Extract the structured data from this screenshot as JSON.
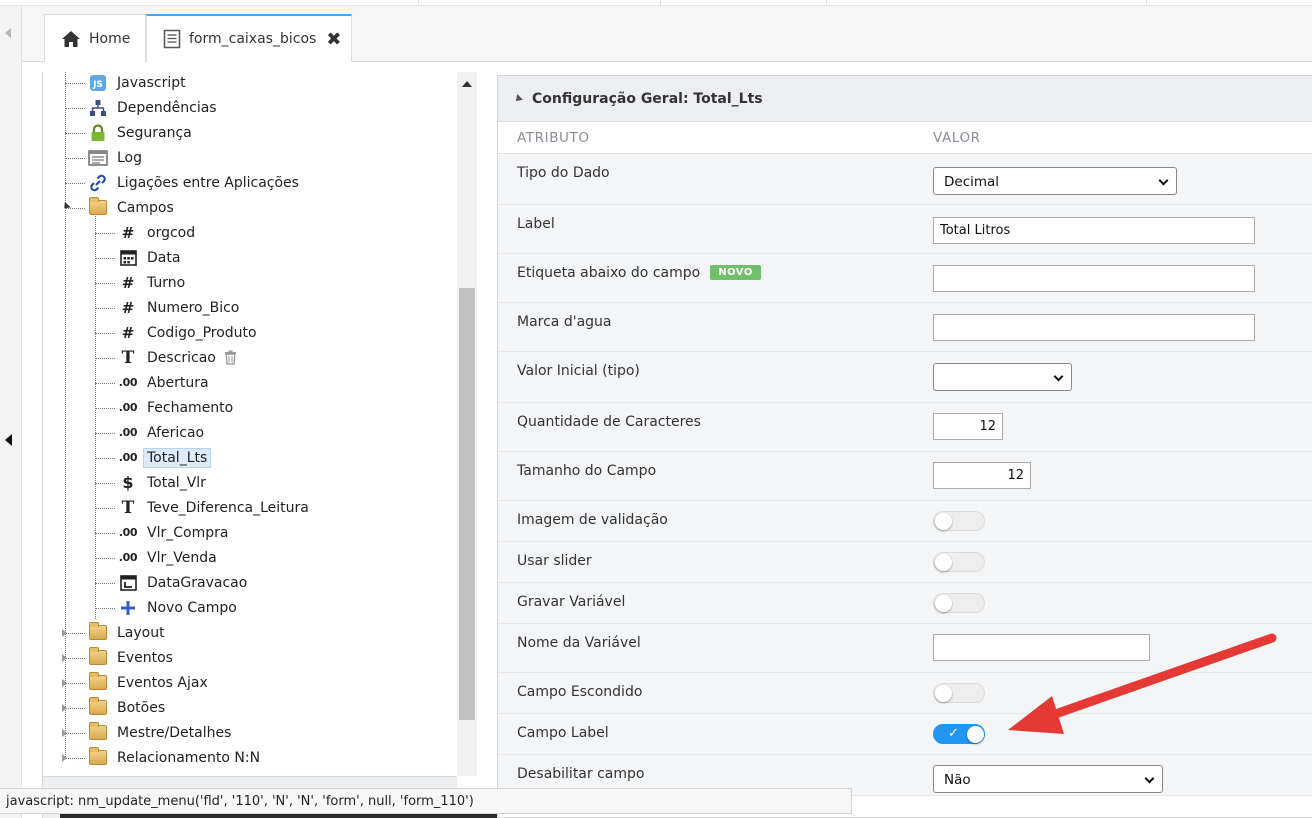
{
  "tabs": [
    {
      "label": "Home",
      "icon": "home-icon"
    },
    {
      "label": "form_caixas_bicos",
      "icon": "document-icon",
      "closable": true
    }
  ],
  "tree": {
    "items": [
      {
        "label": "Javascript",
        "icon": "js-icon"
      },
      {
        "label": "Dependências",
        "icon": "sitemap-icon"
      },
      {
        "label": "Segurança",
        "icon": "lock-icon"
      },
      {
        "label": "Log",
        "icon": "log-icon"
      },
      {
        "label": "Ligações entre Aplicações",
        "icon": "link-icon"
      },
      {
        "label": "Campos",
        "icon": "folder-icon",
        "expanded": true
      },
      {
        "label": "orgcod",
        "icon": "hash-icon",
        "glyph": "#"
      },
      {
        "label": "Data",
        "icon": "calendar-icon"
      },
      {
        "label": "Turno",
        "icon": "hash-icon",
        "glyph": "#"
      },
      {
        "label": "Numero_Bico",
        "icon": "hash-icon",
        "glyph": "#"
      },
      {
        "label": "Codigo_Produto",
        "icon": "hash-icon",
        "glyph": "#"
      },
      {
        "label": "Descricao",
        "icon": "text-icon",
        "glyph": "T",
        "trash": true
      },
      {
        "label": "Abertura",
        "icon": "decimal-icon",
        "glyph": ".00"
      },
      {
        "label": "Fechamento",
        "icon": "decimal-icon",
        "glyph": ".00"
      },
      {
        "label": "Afericao",
        "icon": "decimal-icon",
        "glyph": ".00"
      },
      {
        "label": "Total_Lts",
        "icon": "decimal-icon",
        "glyph": ".00",
        "selected": true
      },
      {
        "label": "Total_Vlr",
        "icon": "currency-icon",
        "glyph": "$"
      },
      {
        "label": "Teve_Diferenca_Leitura",
        "icon": "text-icon",
        "glyph": "T"
      },
      {
        "label": "Vlr_Compra",
        "icon": "decimal-icon",
        "glyph": ".00"
      },
      {
        "label": "Vlr_Venda",
        "icon": "decimal-icon",
        "glyph": ".00"
      },
      {
        "label": "DataGravacao",
        "icon": "datetime-icon"
      },
      {
        "label": "Novo Campo",
        "icon": "plus-icon",
        "glyph": "+"
      },
      {
        "label": "Layout",
        "icon": "folder-icon"
      },
      {
        "label": "Eventos",
        "icon": "folder-icon"
      },
      {
        "label": "Eventos Ajax",
        "icon": "folder-icon"
      },
      {
        "label": "Botões",
        "icon": "folder-icon"
      },
      {
        "label": "Mestre/Detalhes",
        "icon": "folder-icon"
      },
      {
        "label": "Relacionamento N:N",
        "icon": "folder-icon"
      }
    ]
  },
  "config": {
    "title": "Configuração Geral: Total_Lts",
    "col_attr": "ATRIBUTO",
    "col_value": "VALOR",
    "new_badge": "NOVO",
    "rows": [
      {
        "label": "Tipo do Dado",
        "type": "select",
        "value": "Decimal"
      },
      {
        "label": "Label",
        "type": "text",
        "value": "Total Litros"
      },
      {
        "label": "Etiqueta abaixo do campo",
        "type": "text",
        "value": "",
        "badge": true
      },
      {
        "label": "Marca d'agua",
        "type": "text",
        "value": ""
      },
      {
        "label": "Valor Inicial (tipo)",
        "type": "select",
        "value": ""
      },
      {
        "label": "Quantidade de Caracteres",
        "type": "number",
        "value": "12"
      },
      {
        "label": "Tamanho do Campo",
        "type": "number",
        "value": "12"
      },
      {
        "label": "Imagem de validação",
        "type": "toggle",
        "value": false
      },
      {
        "label": "Usar slider",
        "type": "toggle",
        "value": false
      },
      {
        "label": "Gravar Variável",
        "type": "toggle",
        "value": false
      },
      {
        "label": "Nome da Variável",
        "type": "text",
        "value": ""
      },
      {
        "label": "Campo Escondido",
        "type": "toggle",
        "value": false
      },
      {
        "label": "Campo Label",
        "type": "toggle",
        "value": true
      },
      {
        "label": "Desabilitar campo",
        "type": "select",
        "value": "Não"
      }
    ]
  },
  "status_bar": {
    "text": "javascript: nm_update_menu('fld', '110', 'N', 'N', 'form', null, 'form_110')"
  },
  "colors": {
    "accent": "#2196f3",
    "arrow": "#e53935",
    "badge": "#6fbf6c"
  }
}
